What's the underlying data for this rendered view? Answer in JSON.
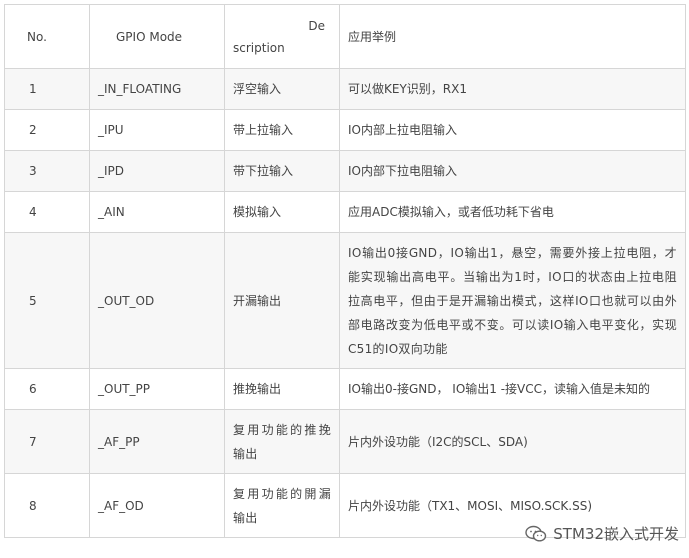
{
  "table": {
    "headers": {
      "no": "No.",
      "mode": "GPIO Mode",
      "description_part1": "De",
      "description_part2": "scription",
      "example": "应用举例"
    },
    "rows": [
      {
        "no": "1",
        "mode": "_IN_FLOATING",
        "description": "浮空输入",
        "example": "可以做KEY识别，RX1"
      },
      {
        "no": "2",
        "mode": "_IPU",
        "description": "带上拉输入",
        "example": "IO内部上拉电阻输入"
      },
      {
        "no": "3",
        "mode": "_IPD",
        "description": "带下拉输入",
        "example": "IO内部下拉电阻输入"
      },
      {
        "no": "4",
        "mode": "_AIN",
        "description": "模拟输入",
        "example": "应用ADC模拟输入，或者低功耗下省电"
      },
      {
        "no": "5",
        "mode": "_OUT_OD",
        "description": "开漏输出",
        "example": "IO输出0接GND，IO输出1，悬空，需要外接上拉电阻，才能实现输出高电平。当输出为1时，IO口的状态由上拉电阻拉高电平，但由于是开漏输出模式，这样IO口也就可以由外部电路改变为低电平或不变。可以读IO输入电平变化，实现C51的IO双向功能"
      },
      {
        "no": "6",
        "mode": "_OUT_PP",
        "description": "推挽输出",
        "example": "IO输出0-接GND， IO输出1 -接VCC，读输入值是未知的"
      },
      {
        "no": "7",
        "mode": "_AF_PP",
        "description": "复用功能的推挽输出",
        "example": "片内外设功能（I2C的SCL、SDA)"
      },
      {
        "no": "8",
        "mode": "_AF_OD",
        "description": "复用功能的開漏输出",
        "example": "片内外设功能（TX1、MOSI、MISO.SCK.SS)"
      }
    ]
  },
  "watermark": {
    "text": "STM32嵌入式开发",
    "icon": "wechat-icon"
  }
}
